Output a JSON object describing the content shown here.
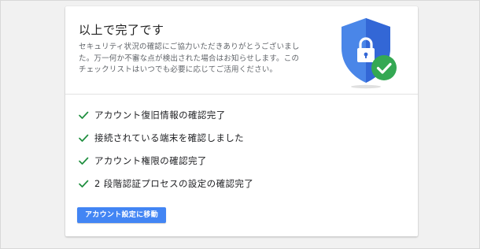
{
  "card": {
    "title": "以上で完了です",
    "description_lines": [
      "セキュリティ状況の確認にご協力いただきありがとうございまし",
      "た。万一何か不審な点が検出された場合はお知らせします。この",
      "チェックリストはいつでも必要に応じてご活用ください。"
    ],
    "illustration": {
      "icon": "security-shield-lock-icon",
      "badge_icon": "checkmark-badge-icon",
      "colors": {
        "shield_left": "#4a86e8",
        "shield_right": "#3367d6",
        "badge": "#34a853"
      }
    }
  },
  "checklist": [
    {
      "icon": "checkmark-icon",
      "label": "アカウント復旧情報の確認完了"
    },
    {
      "icon": "checkmark-icon",
      "label": "接続されている端末を確認しました"
    },
    {
      "icon": "checkmark-icon",
      "label": "アカウント権限の確認完了"
    },
    {
      "icon": "checkmark-icon",
      "label": "2 段階認証プロセスの設定の確認完了"
    }
  ],
  "action_button": {
    "label": "アカウント設定に移動",
    "color": "#4285f4"
  },
  "colors": {
    "check": "#1e8e3e",
    "page_background": "#f1f1f1"
  }
}
